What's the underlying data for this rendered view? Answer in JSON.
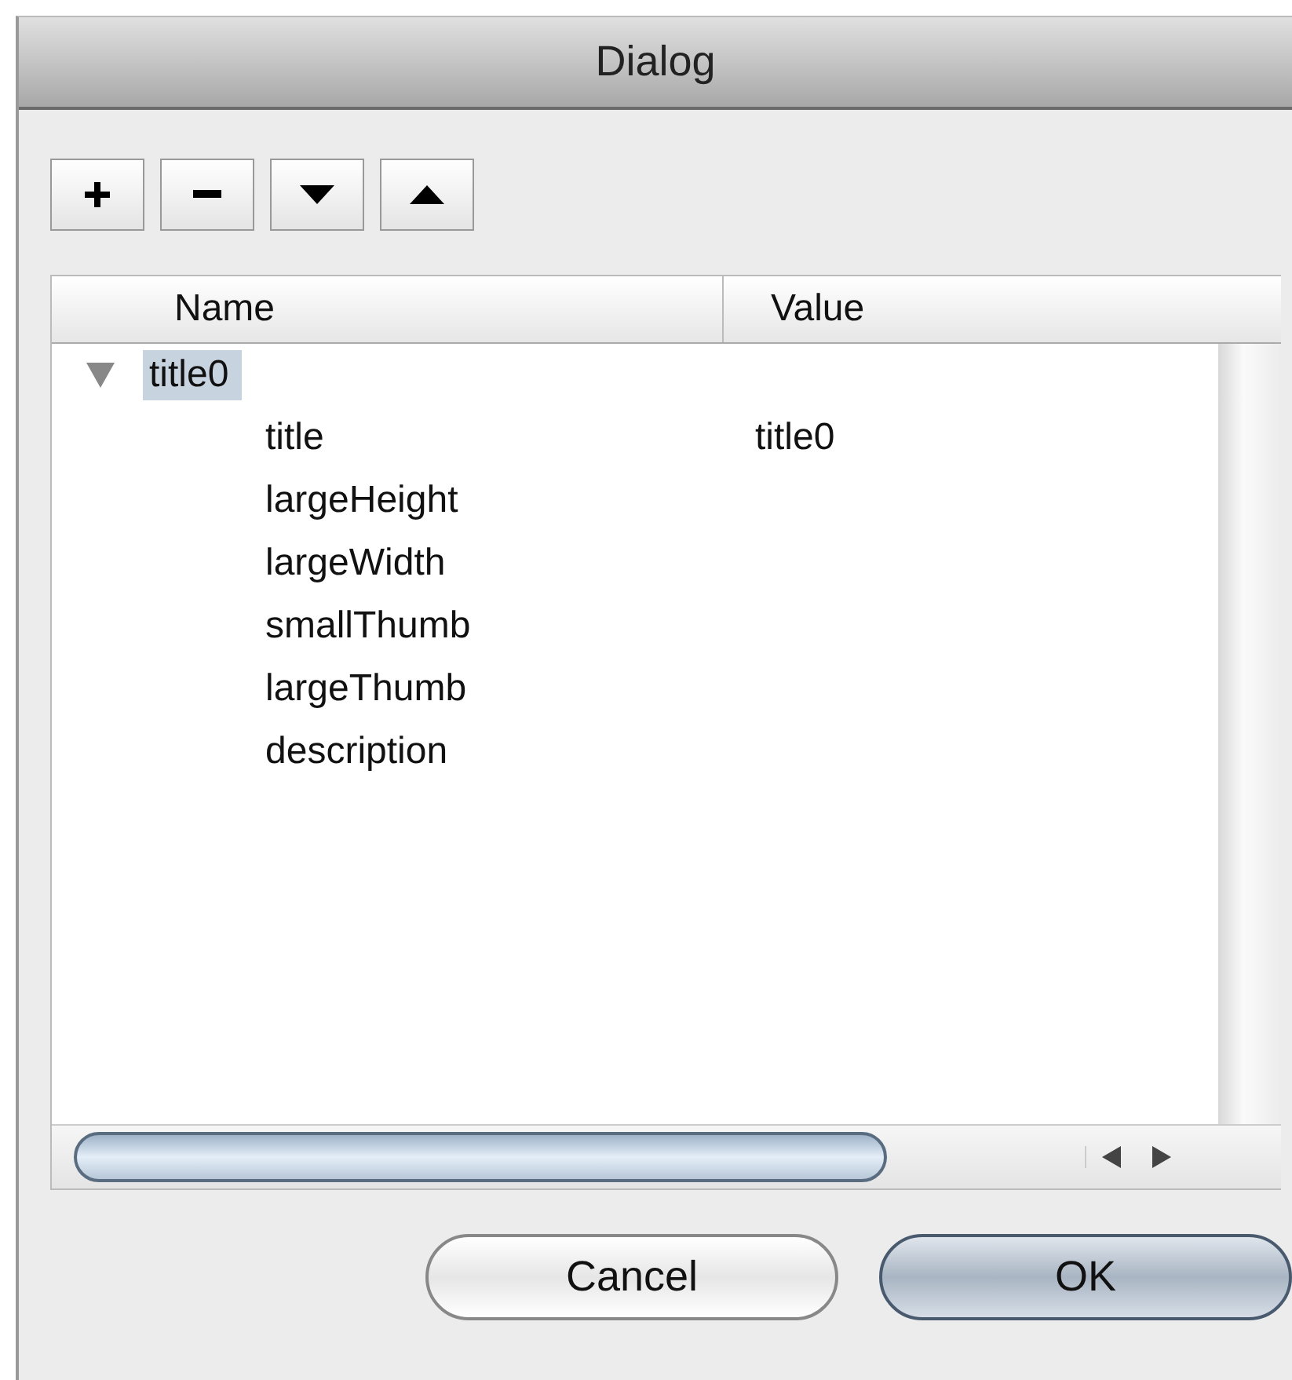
{
  "window": {
    "title": "Dialog"
  },
  "tree": {
    "columns": [
      "Name",
      "Value"
    ],
    "rows": [
      {
        "name": "title0",
        "expanded": true,
        "selected": true,
        "children": [
          {
            "name": "title",
            "value": "title0",
            "selected": false
          },
          {
            "name": "largeHeight",
            "selected": false
          },
          {
            "name": "largeWidth",
            "selected": false
          },
          {
            "name": "smallThumb",
            "selected": false
          },
          {
            "name": "largeThumb",
            "selected": false
          },
          {
            "name": "description",
            "selected": false
          }
        ]
      }
    ]
  },
  "buttons": [
    {
      "label": "Cancel",
      "default": false
    },
    {
      "label": "OK",
      "default": true
    }
  ]
}
